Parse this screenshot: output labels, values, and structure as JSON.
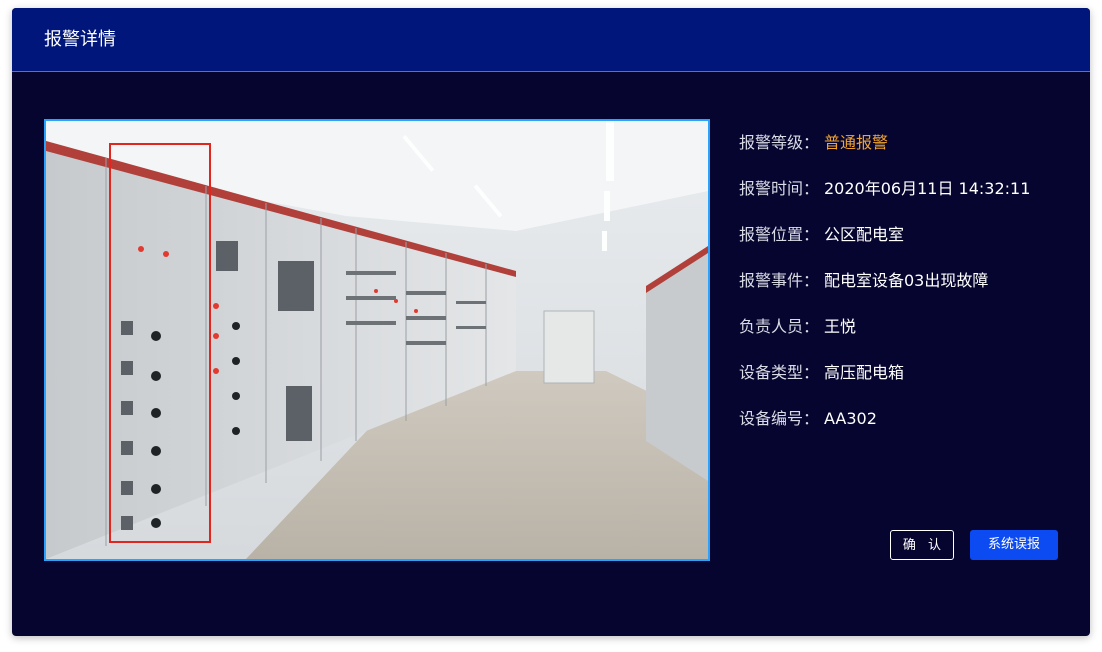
{
  "dialog": {
    "title": "报警详情"
  },
  "details": [
    {
      "label": "报警等级：",
      "value": "普通报警",
      "color": "#f0a330"
    },
    {
      "label": "报警时间：",
      "value": "2020年06月11日 14:32:11",
      "color": "#ffffff"
    },
    {
      "label": "报警位置：",
      "value": "公区配电室",
      "color": "#ffffff"
    },
    {
      "label": "报警事件：",
      "value": "配电室设备03出现故障",
      "color": "#ffffff"
    },
    {
      "label": "负责人员：",
      "value": "王悦",
      "color": "#ffffff"
    },
    {
      "label": "设备类型：",
      "value": "高压配电箱",
      "color": "#ffffff"
    },
    {
      "label": "设备编号：",
      "value": "AA302",
      "color": "#ffffff"
    }
  ],
  "buttons": {
    "confirm": "确 认",
    "false_alarm": "系统误报"
  },
  "colors": {
    "header": "#01167a",
    "body": "#06052f",
    "highlight_box": "#e0261f",
    "photo_border": "#2aa3ff",
    "primary_button": "#0d4bf2"
  },
  "image": {
    "alt": "配电室监控画面",
    "highlight": "red rectangle around a switchgear cabinet"
  }
}
